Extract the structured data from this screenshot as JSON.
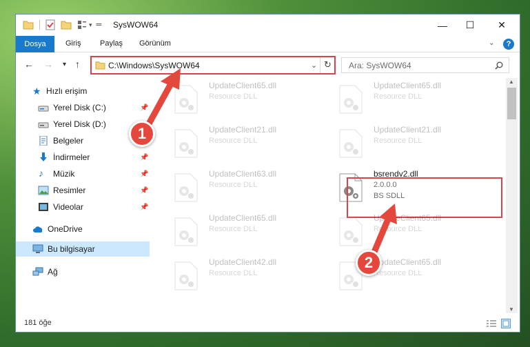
{
  "window": {
    "title": "SysWOW64",
    "buttons": {
      "minimize": "—",
      "maximize": "☐",
      "close": "✕"
    }
  },
  "ribbon": {
    "file_tab": "Dosya",
    "tabs": [
      "Giriş",
      "Paylaş",
      "Görünüm"
    ],
    "help": "?"
  },
  "nav": {
    "back": "←",
    "forward": "→",
    "recent": "▾",
    "up": "↑",
    "address": "C:\\Windows\\SysWOW64",
    "search_placeholder": "Ara: SysWOW64"
  },
  "sidebar": {
    "quick_access": "Hızlı erişim",
    "items": [
      {
        "label": "Yerel Disk (C:)",
        "icon": "drive-icon",
        "pinned": true
      },
      {
        "label": "Yerel Disk (D:)",
        "icon": "drive-icon",
        "pinned": false
      },
      {
        "label": "Belgeler",
        "icon": "documents-icon",
        "pinned": true
      },
      {
        "label": "İndirmeler",
        "icon": "downloads-icon",
        "pinned": true
      },
      {
        "label": "Müzik",
        "icon": "music-icon",
        "pinned": true
      },
      {
        "label": "Resimler",
        "icon": "pictures-icon",
        "pinned": true
      },
      {
        "label": "Videolar",
        "icon": "videos-icon",
        "pinned": true
      }
    ],
    "onedrive": "OneDrive",
    "this_pc": "Bu bilgisayar",
    "network": "Ağ"
  },
  "files": [
    {
      "name": "UpdateClient65.dll",
      "line2": "Resource DLL",
      "line3": ""
    },
    {
      "name": "UpdateClient65.dll",
      "line2": "Resource DLL",
      "line3": ""
    },
    {
      "name": "UpdateClient21.dll",
      "line2": "Resource DLL",
      "line3": ""
    },
    {
      "name": "UpdateClient21.dll",
      "line2": "Resource DLL",
      "line3": ""
    },
    {
      "name": "UpdateClient63.dll",
      "line2": "Resource DLL",
      "line3": ""
    },
    {
      "name": "bsrendv2.dll",
      "line2": "2.0.0.0",
      "line3": "BS SDLL"
    },
    {
      "name": "UpdateClient65.dll",
      "line2": "Resource DLL",
      "line3": ""
    },
    {
      "name": "UpdateClient65.dll",
      "line2": "Resource DLL",
      "line3": ""
    },
    {
      "name": "UpdateClient42.dll",
      "line2": "Resource DLL",
      "line3": ""
    },
    {
      "name": "UpdateClient65.dll",
      "line2": "Resource DLL",
      "line3": ""
    }
  ],
  "status": {
    "item_count": "181 öğe"
  },
  "callouts": [
    "1",
    "2"
  ],
  "colors": {
    "accent": "#1979ca",
    "highlight": "#d9444a",
    "callout": "#e4483d",
    "selected": "#cce8ff"
  }
}
